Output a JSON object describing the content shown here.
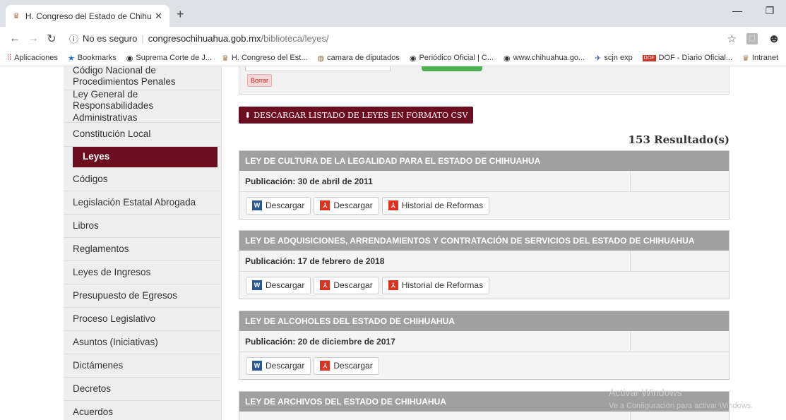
{
  "browser": {
    "tab_title": "H. Congreso del Estado de Chihu",
    "new_tab": "+",
    "address": {
      "security": "No es seguro",
      "host": "congresochihuahua.gob.mx",
      "path": "/biblioteca/leyes/"
    },
    "bookmarks": [
      "Aplicaciones",
      "Bookmarks",
      "Suprema Corte de J...",
      "H. Congreso del Est...",
      "camara de diputados",
      "Periódico Oficial | C...",
      "www.chihuahua.go...",
      "scjn exp",
      "DOF - Diario Oficial...",
      "Intranet"
    ]
  },
  "sidebar": {
    "items": [
      "Código Nacional de Procedimientos Penales",
      "Ley General de Responsabilidades Administrativas",
      "Constitución Local",
      "Leyes",
      "Códigos",
      "Legislación Estatal Abrogada",
      "Libros",
      "Reglamentos",
      "Leyes de Ingresos",
      "Presupuesto de Egresos",
      "Proceso Legislativo",
      "Asuntos (Iniciativas)",
      "Dictámenes",
      "Decretos",
      "Acuerdos"
    ],
    "active": "Leyes"
  },
  "filter": {
    "clear_label": "Borrar"
  },
  "csv_button": "DESCARGAR LISTADO DE LEYES EN FORMATO CSV",
  "results_count": "153 Resultado(s)",
  "laws": [
    {
      "title": "LEY DE CULTURA DE LA LEGALIDAD PARA EL ESTADO DE CHIHUAHUA",
      "publication": "Publicación: 30 de abril de 2011",
      "word_label": "Descargar",
      "pdf_label": "Descargar",
      "history_label": "Historial de Reformas"
    },
    {
      "title": "LEY DE ADQUISICIONES, ARRENDAMIENTOS Y CONTRATACIÓN DE SERVICIOS DEL ESTADO DE CHIHUAHUA",
      "publication": "Publicación: 17 de febrero de 2018",
      "word_label": "Descargar",
      "pdf_label": "Descargar",
      "history_label": "Historial de Reformas"
    },
    {
      "title": "LEY DE ALCOHOLES DEL ESTADO DE CHIHUAHUA",
      "publication": "Publicación: 20 de diciembre de 2017",
      "word_label": "Descargar",
      "pdf_label": "Descargar"
    },
    {
      "title": "LEY DE ARCHIVOS DEL ESTADO DE CHIHUAHUA"
    }
  ],
  "watermark": {
    "title": "Activar Windows",
    "subtitle": "Ve a Configuración para activar Windows."
  }
}
